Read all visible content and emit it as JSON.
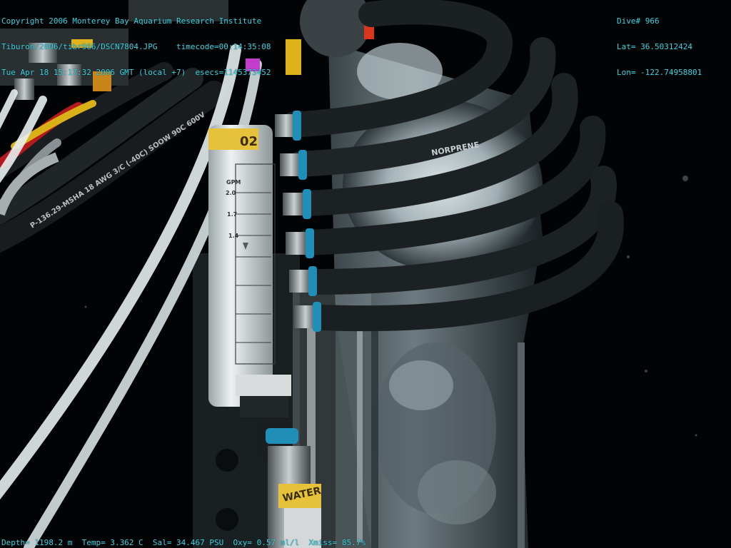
{
  "overlay": {
    "header_left": [
      "Copyright 2006 Monterey Bay Aquarium Research Institute",
      "Tiburon/2006/tibr966/DSCN7804.JPG    timecode=00:14:35:08",
      "Tue Apr 18 15:17:32 2006 GMT (local +7)  esecs=1145373452"
    ],
    "header_right": [
      "Dive# 966",
      "Lat= 36.50312424",
      "Lon= -122.74958801"
    ],
    "footer": "Depth= 1198.2 m  Temp= 3.362 C  Sal= 34.467 PSU  Oxy= 0.57 ml/l  Xmiss= 85.7%"
  },
  "labels": {
    "hose_brand": "NORPRENE",
    "cable_marking": "P-136.29-MSHA 18 AWG 3/C (-40C) SOOW 90C 600V",
    "flowmeter_unit": "GPM",
    "flowmeter_top_tag": "02",
    "flowmeter_ticks": [
      "2.0",
      "1.7",
      "1.4"
    ],
    "water_tag": "WATER"
  },
  "colors": {
    "overlay_text": "#39d6e6",
    "hose": "#1b2022",
    "collar": "#1f8fb8",
    "tubing": "#dfe8ea",
    "background": "#020304"
  }
}
